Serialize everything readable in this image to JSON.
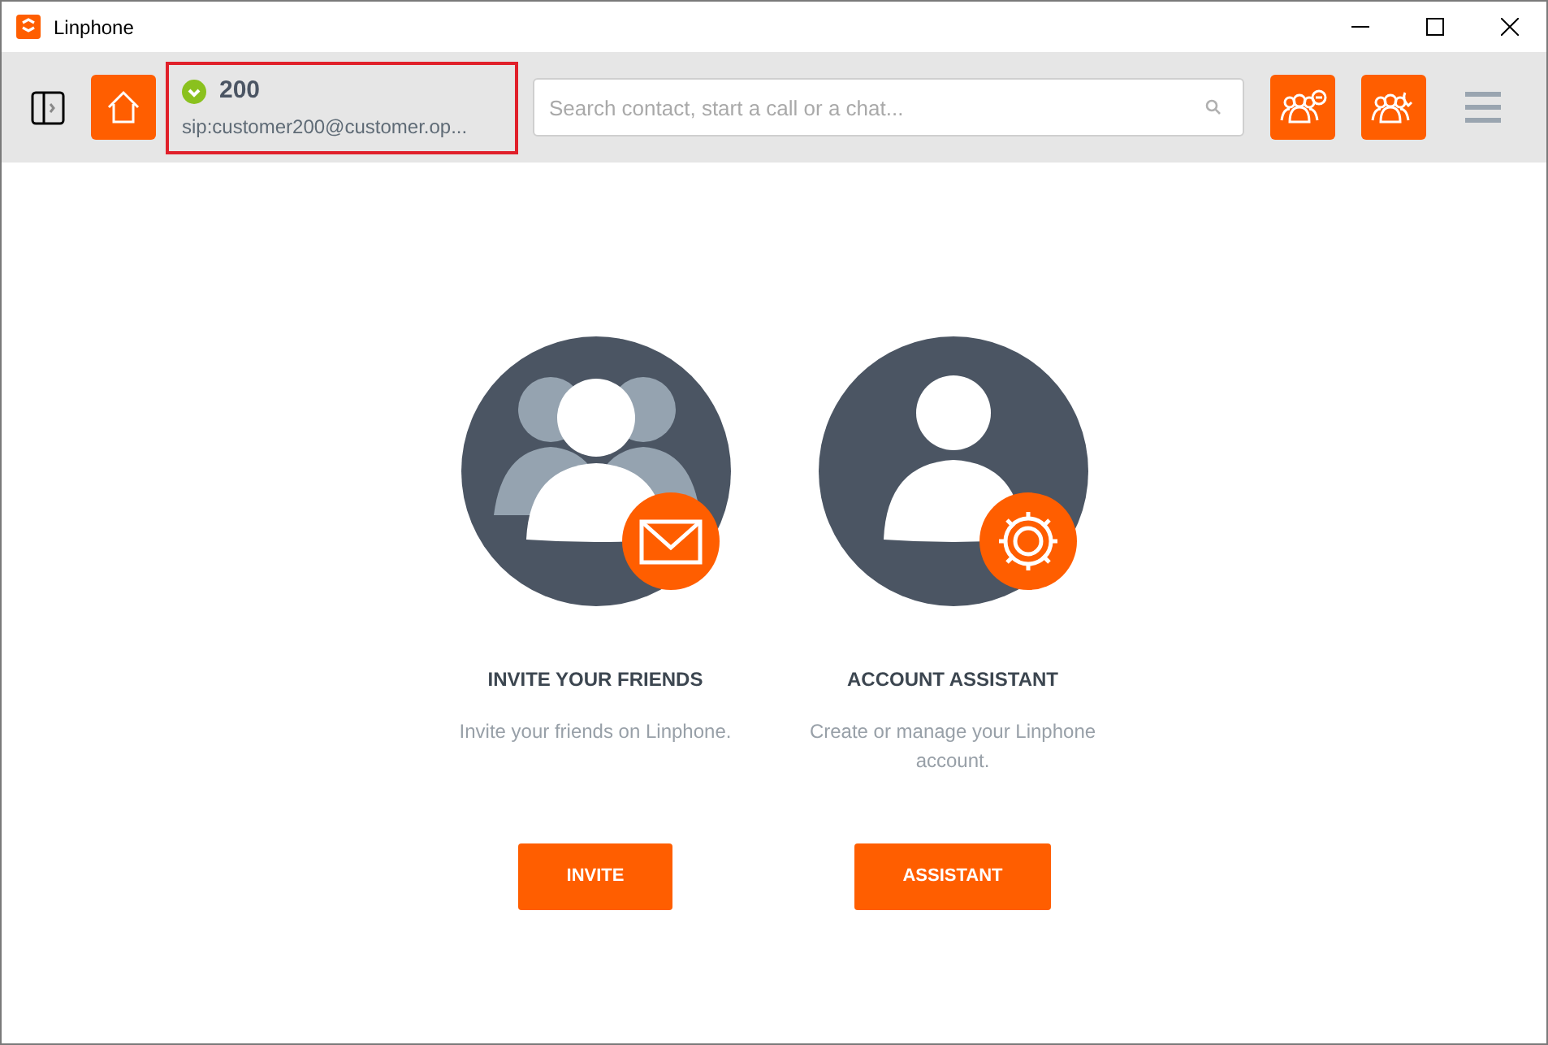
{
  "window": {
    "title": "Linphone"
  },
  "account": {
    "name": "200",
    "address": "sip:customer200@customer.op...",
    "registered": true
  },
  "search": {
    "placeholder": "Search contact, start a call or a chat..."
  },
  "cards": [
    {
      "kind": "invite",
      "title": "INVITE YOUR FRIENDS",
      "description": "Invite your friends on Linphone.",
      "button": "INVITE"
    },
    {
      "kind": "assistant",
      "title": "ACCOUNT ASSISTANT",
      "description": "Create or manage your Linphone account.",
      "button": "ASSISTANT"
    }
  ]
}
